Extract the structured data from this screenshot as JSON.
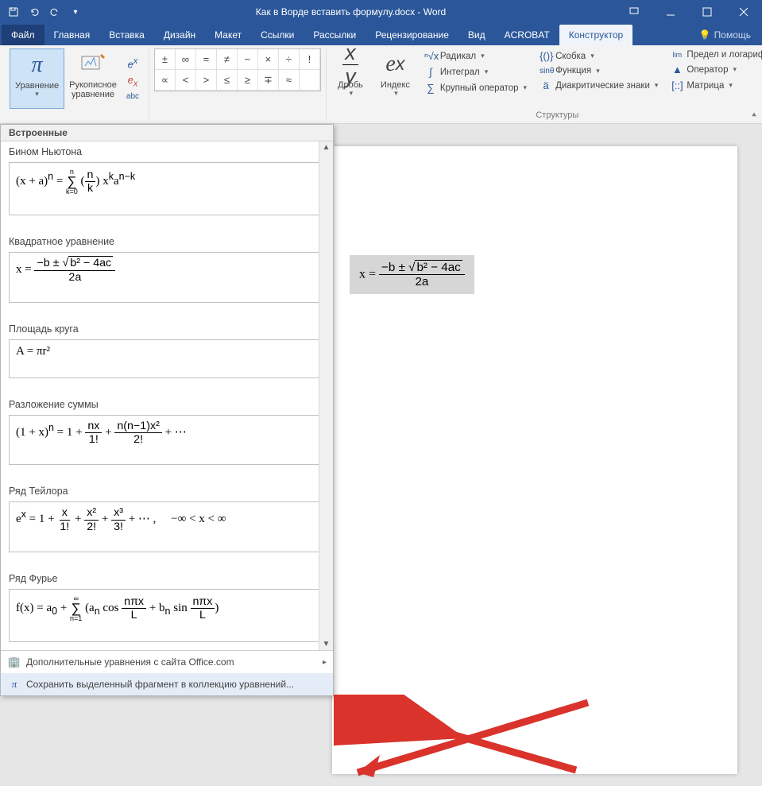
{
  "title": "Как в Ворде вставить формулу.docx - Word",
  "menu": {
    "file": "Файл",
    "home": "Главная",
    "insert": "Вставка",
    "design": "Дизайн",
    "layout": "Макет",
    "refs": "Ссылки",
    "mail": "Рассылки",
    "review": "Рецензирование",
    "view": "Вид",
    "acrobat": "ACROBAT",
    "constructor": "Конструктор",
    "help": "Помощь"
  },
  "ribbon": {
    "equation": "Уравнение",
    "ink": "Рукописное уравнение",
    "fraction": "Дробь",
    "index": "Индекс",
    "radical": "Радикал",
    "integral": "Интеграл",
    "largeop": "Крупный оператор",
    "bracket": "Скобка",
    "function": "Функция",
    "diacritic": "Диакритические знаки",
    "limit": "Предел и логарифм",
    "operator": "Оператор",
    "matrix": "Матрица",
    "structures": "Структуры"
  },
  "symbols": [
    "±",
    "∞",
    "=",
    "≠",
    "~",
    "×",
    "÷",
    "!",
    "∝",
    "<",
    ">",
    "≤",
    "≥",
    "∓",
    "≈"
  ],
  "gallery": {
    "header": "Встроенные",
    "items": [
      {
        "title": "Бином Ньютона",
        "formula": "(x + a)<sup>n</sup> = <span class='lim'><span>n</span><span class='bigop'>∑</span><span>k=0</span></span> (<span class='frac'><span class='n'>n</span><span class='d'>k</span></span>) x<sup>k</sup>a<sup>n−k</sup>"
      },
      {
        "title": "Квадратное уравнение",
        "formula": "x = <span class='frac'><span class='n'>−b ± <span class='sq'><span class='rad'>b² − 4ac</span></span></span><span class='d'>2a</span></span>"
      },
      {
        "title": "Площадь круга",
        "formula": "A = πr²"
      },
      {
        "title": "Разложение суммы",
        "formula": "(1 + x)<sup>n</sup> = 1 + <span class='frac'><span class='n'>nx</span><span class='d'>1!</span></span> + <span class='frac'><span class='n'>n(n−1)x²</span><span class='d'>2!</span></span> + ⋯"
      },
      {
        "title": "Ряд Тейлора",
        "formula": "e<sup>x</sup> = 1 + <span class='frac'><span class='n'>x</span><span class='d'>1!</span></span> + <span class='frac'><span class='n'>x²</span><span class='d'>2!</span></span> + <span class='frac'><span class='n'>x³</span><span class='d'>3!</span></span> + ⋯ , &nbsp;&nbsp;&nbsp; −∞ &lt; x &lt; ∞"
      },
      {
        "title": "Ряд Фурье",
        "formula": "f(x) = a<sub>0</sub> + <span class='lim'><span>∞</span><span class='bigop'>∑</span><span>n=1</span></span> (a<sub>n</sub> cos <span class='frac'><span class='n'>nπx</span><span class='d'>L</span></span> + b<sub>n</sub> sin <span class='frac'><span class='n'>nπx</span><span class='d'>L</span></span>)"
      }
    ],
    "more": "Дополнительные уравнения с сайта Office.com",
    "save": "Сохранить выделенный фрагмент в коллекцию уравнений..."
  },
  "doc_formula": "x = <span class='frac'><span class='n'>−b ± <span class='sq'><span class='rad'>b² − 4ac</span></span></span><span class='d'>2a</span></span>"
}
